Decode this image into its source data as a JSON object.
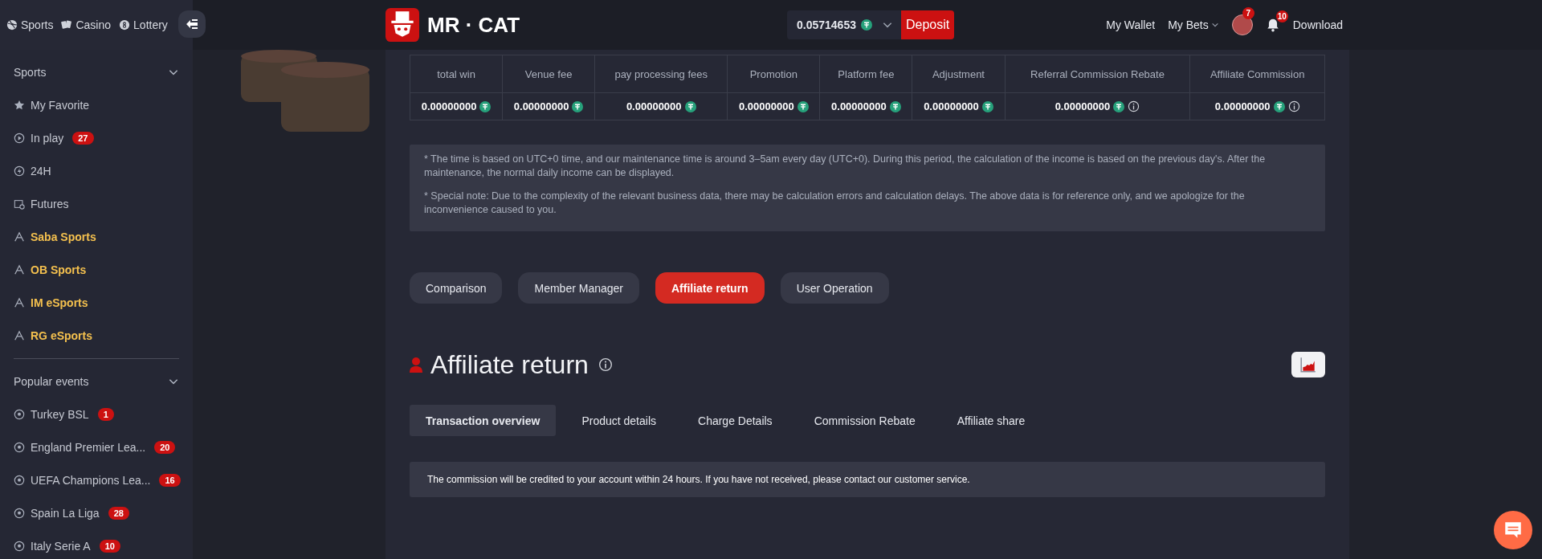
{
  "header": {
    "nav": [
      {
        "label": "Sports"
      },
      {
        "label": "Casino"
      },
      {
        "label": "Lottery"
      }
    ],
    "logo": "MR · CAT",
    "balance": "0.05714653",
    "deposit": "Deposit",
    "links": [
      "My Wallet",
      "My Bets"
    ],
    "avatar_badge": "7",
    "bell_badge": "10",
    "download": "Download"
  },
  "sidebar": {
    "sections": [
      {
        "title": "Sports",
        "expanded": true,
        "items": [
          {
            "label": "My Favorite",
            "highlighted": false
          },
          {
            "label": "In play",
            "badge": "27",
            "highlighted": false
          },
          {
            "label": "24H",
            "highlighted": false
          },
          {
            "label": "Futures",
            "highlighted": false
          },
          {
            "label": "Saba Sports",
            "highlighted": true
          },
          {
            "label": "OB Sports",
            "highlighted": true
          },
          {
            "label": "IM eSports",
            "highlighted": true
          },
          {
            "label": "RG eSports",
            "highlighted": true
          }
        ]
      },
      {
        "title": "Popular events",
        "expanded": true,
        "items": [
          {
            "label": "Turkey BSL",
            "badge": "1",
            "highlighted": false
          },
          {
            "label": "England Premier Lea...",
            "badge": "20",
            "highlighted": false
          },
          {
            "label": "UEFA Champions Lea...",
            "badge": "16",
            "highlighted": false
          },
          {
            "label": "Spain La Liga",
            "badge": "28",
            "highlighted": false
          },
          {
            "label": "Italy Serie A",
            "badge": "10",
            "highlighted": false
          }
        ]
      }
    ]
  },
  "summary_table": {
    "columns": [
      {
        "label": "total win",
        "value": "0.00000000",
        "info": false
      },
      {
        "label": "Venue fee",
        "value": "0.00000000",
        "info": false
      },
      {
        "label": "pay processing fees",
        "value": "0.00000000",
        "info": false
      },
      {
        "label": "Promotion",
        "value": "0.00000000",
        "info": false
      },
      {
        "label": "Platform fee",
        "value": "0.00000000",
        "info": false
      },
      {
        "label": "Adjustment",
        "value": "0.00000000",
        "info": false
      },
      {
        "label": "Referral Commission Rebate",
        "value": "0.00000000",
        "info": true
      },
      {
        "label": "Affiliate Commission",
        "value": "0.00000000",
        "info": true
      }
    ]
  },
  "notes": [
    "* The time is based on UTC+0 time, and our maintenance time is around 3–5am every day (UTC+0). During this period, the calculation of the income is based on the previous day's. After the maintenance, the normal daily income can be displayed.",
    "* Special note: Due to the complexity of the relevant business data, there may be calculation errors and calculation delays. The above data is for reference only, and we apologize for the inconvenience caused to you."
  ],
  "section_tabs": [
    {
      "label": "Comparison",
      "selected": false
    },
    {
      "label": "Member Manager",
      "selected": false
    },
    {
      "label": "Affiliate return",
      "selected": true
    },
    {
      "label": "User Operation",
      "selected": false
    }
  ],
  "page_title": "Affiliate return",
  "sub_tabs": [
    {
      "label": "Transaction overview",
      "selected": true
    },
    {
      "label": "Product details",
      "selected": false
    },
    {
      "label": "Charge Details",
      "selected": false
    },
    {
      "label": "Commission Rebate",
      "selected": false
    },
    {
      "label": "Affiliate share",
      "selected": false
    }
  ],
  "notice": "The commission will be credited to your account within 24 hours. If you have not received, please contact our customer service."
}
